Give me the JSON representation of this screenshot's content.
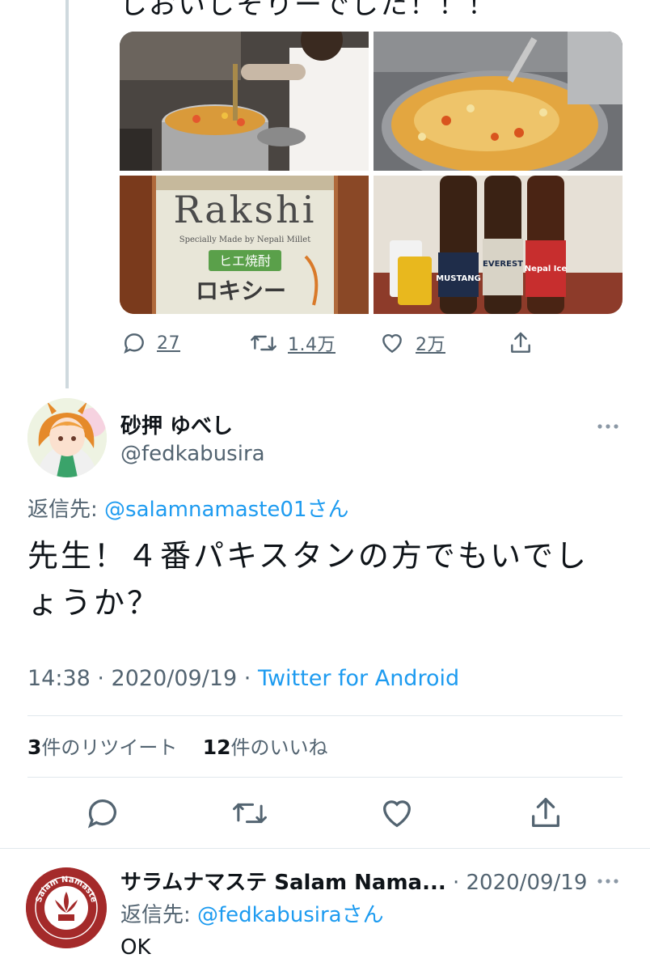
{
  "prev_tweet": {
    "cut_text": "しおいしそりーでした！！！",
    "media": [
      {
        "icon": "photo-cooking-pot-chef"
      },
      {
        "icon": "photo-biryani-pan"
      },
      {
        "icon": "photo-rakshi-bottle",
        "label": "Rakshi",
        "sub": "Specially Made by Nepali Millet",
        "tag": "ヒエ焼酎",
        "brand": "ロキシー"
      },
      {
        "icon": "photo-nepal-beers",
        "beers": [
          "MUSTANG",
          "EVEREST",
          "Nepal Ice"
        ]
      }
    ],
    "actions": {
      "replies": "27",
      "retweets": "1.4万",
      "likes": "2万"
    }
  },
  "tweet": {
    "display_name": "砂押 ゆべし",
    "handle": "@fedkabusira",
    "reply_prefix": "返信先:",
    "reply_to": "@salamnamaste01",
    "reply_suffix": "さん",
    "text": "先生！４番パキスタンの方でもいでしょうか？",
    "time": "14:38 · 2020/09/19 · ",
    "source": "Twitter for Android",
    "retweet_count": "3",
    "retweet_label": "件のリツイート",
    "like_count": "12",
    "like_label": "件のいいね"
  },
  "reply": {
    "display_name": "サラムナマステ Salam Nama...",
    "date": " · 2020/09/19",
    "reply_prefix": "返信先:",
    "reply_to": "@fedkabusira",
    "reply_suffix": "さん",
    "text": "OK",
    "logo_text": "Salam Namaste"
  },
  "colors": {
    "accent": "#1d9bf0",
    "muted": "#536471",
    "divider": "#e1e8ed"
  }
}
